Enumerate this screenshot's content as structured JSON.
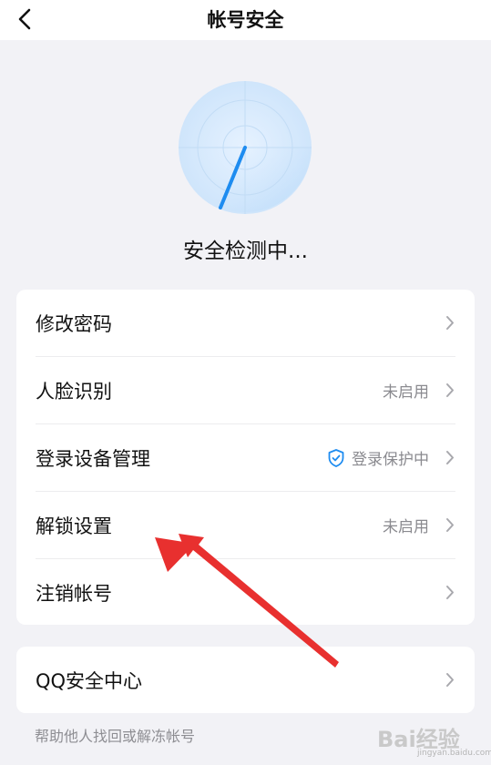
{
  "header": {
    "title": "帐号安全",
    "back_icon": "chevron-left-icon"
  },
  "scan": {
    "status_text": "安全检测中..."
  },
  "menu_main": [
    {
      "label": "修改密码",
      "value": ""
    },
    {
      "label": "人脸识别",
      "value": "未启用"
    },
    {
      "label": "登录设备管理",
      "value": "登录保护中",
      "value_icon": "shield-check-icon"
    },
    {
      "label": "解锁设置",
      "value": "未启用"
    },
    {
      "label": "注销帐号",
      "value": ""
    }
  ],
  "menu_secondary": [
    {
      "label": "QQ安全中心",
      "value": ""
    }
  ],
  "help_text": "帮助他人找回或解冻帐号",
  "watermark": {
    "logo": "Bai经验",
    "url": "jingyan.baidu.com"
  },
  "colors": {
    "accent": "#1e8cf0",
    "arrow": "#e8302f",
    "background": "#f2f2f6"
  }
}
